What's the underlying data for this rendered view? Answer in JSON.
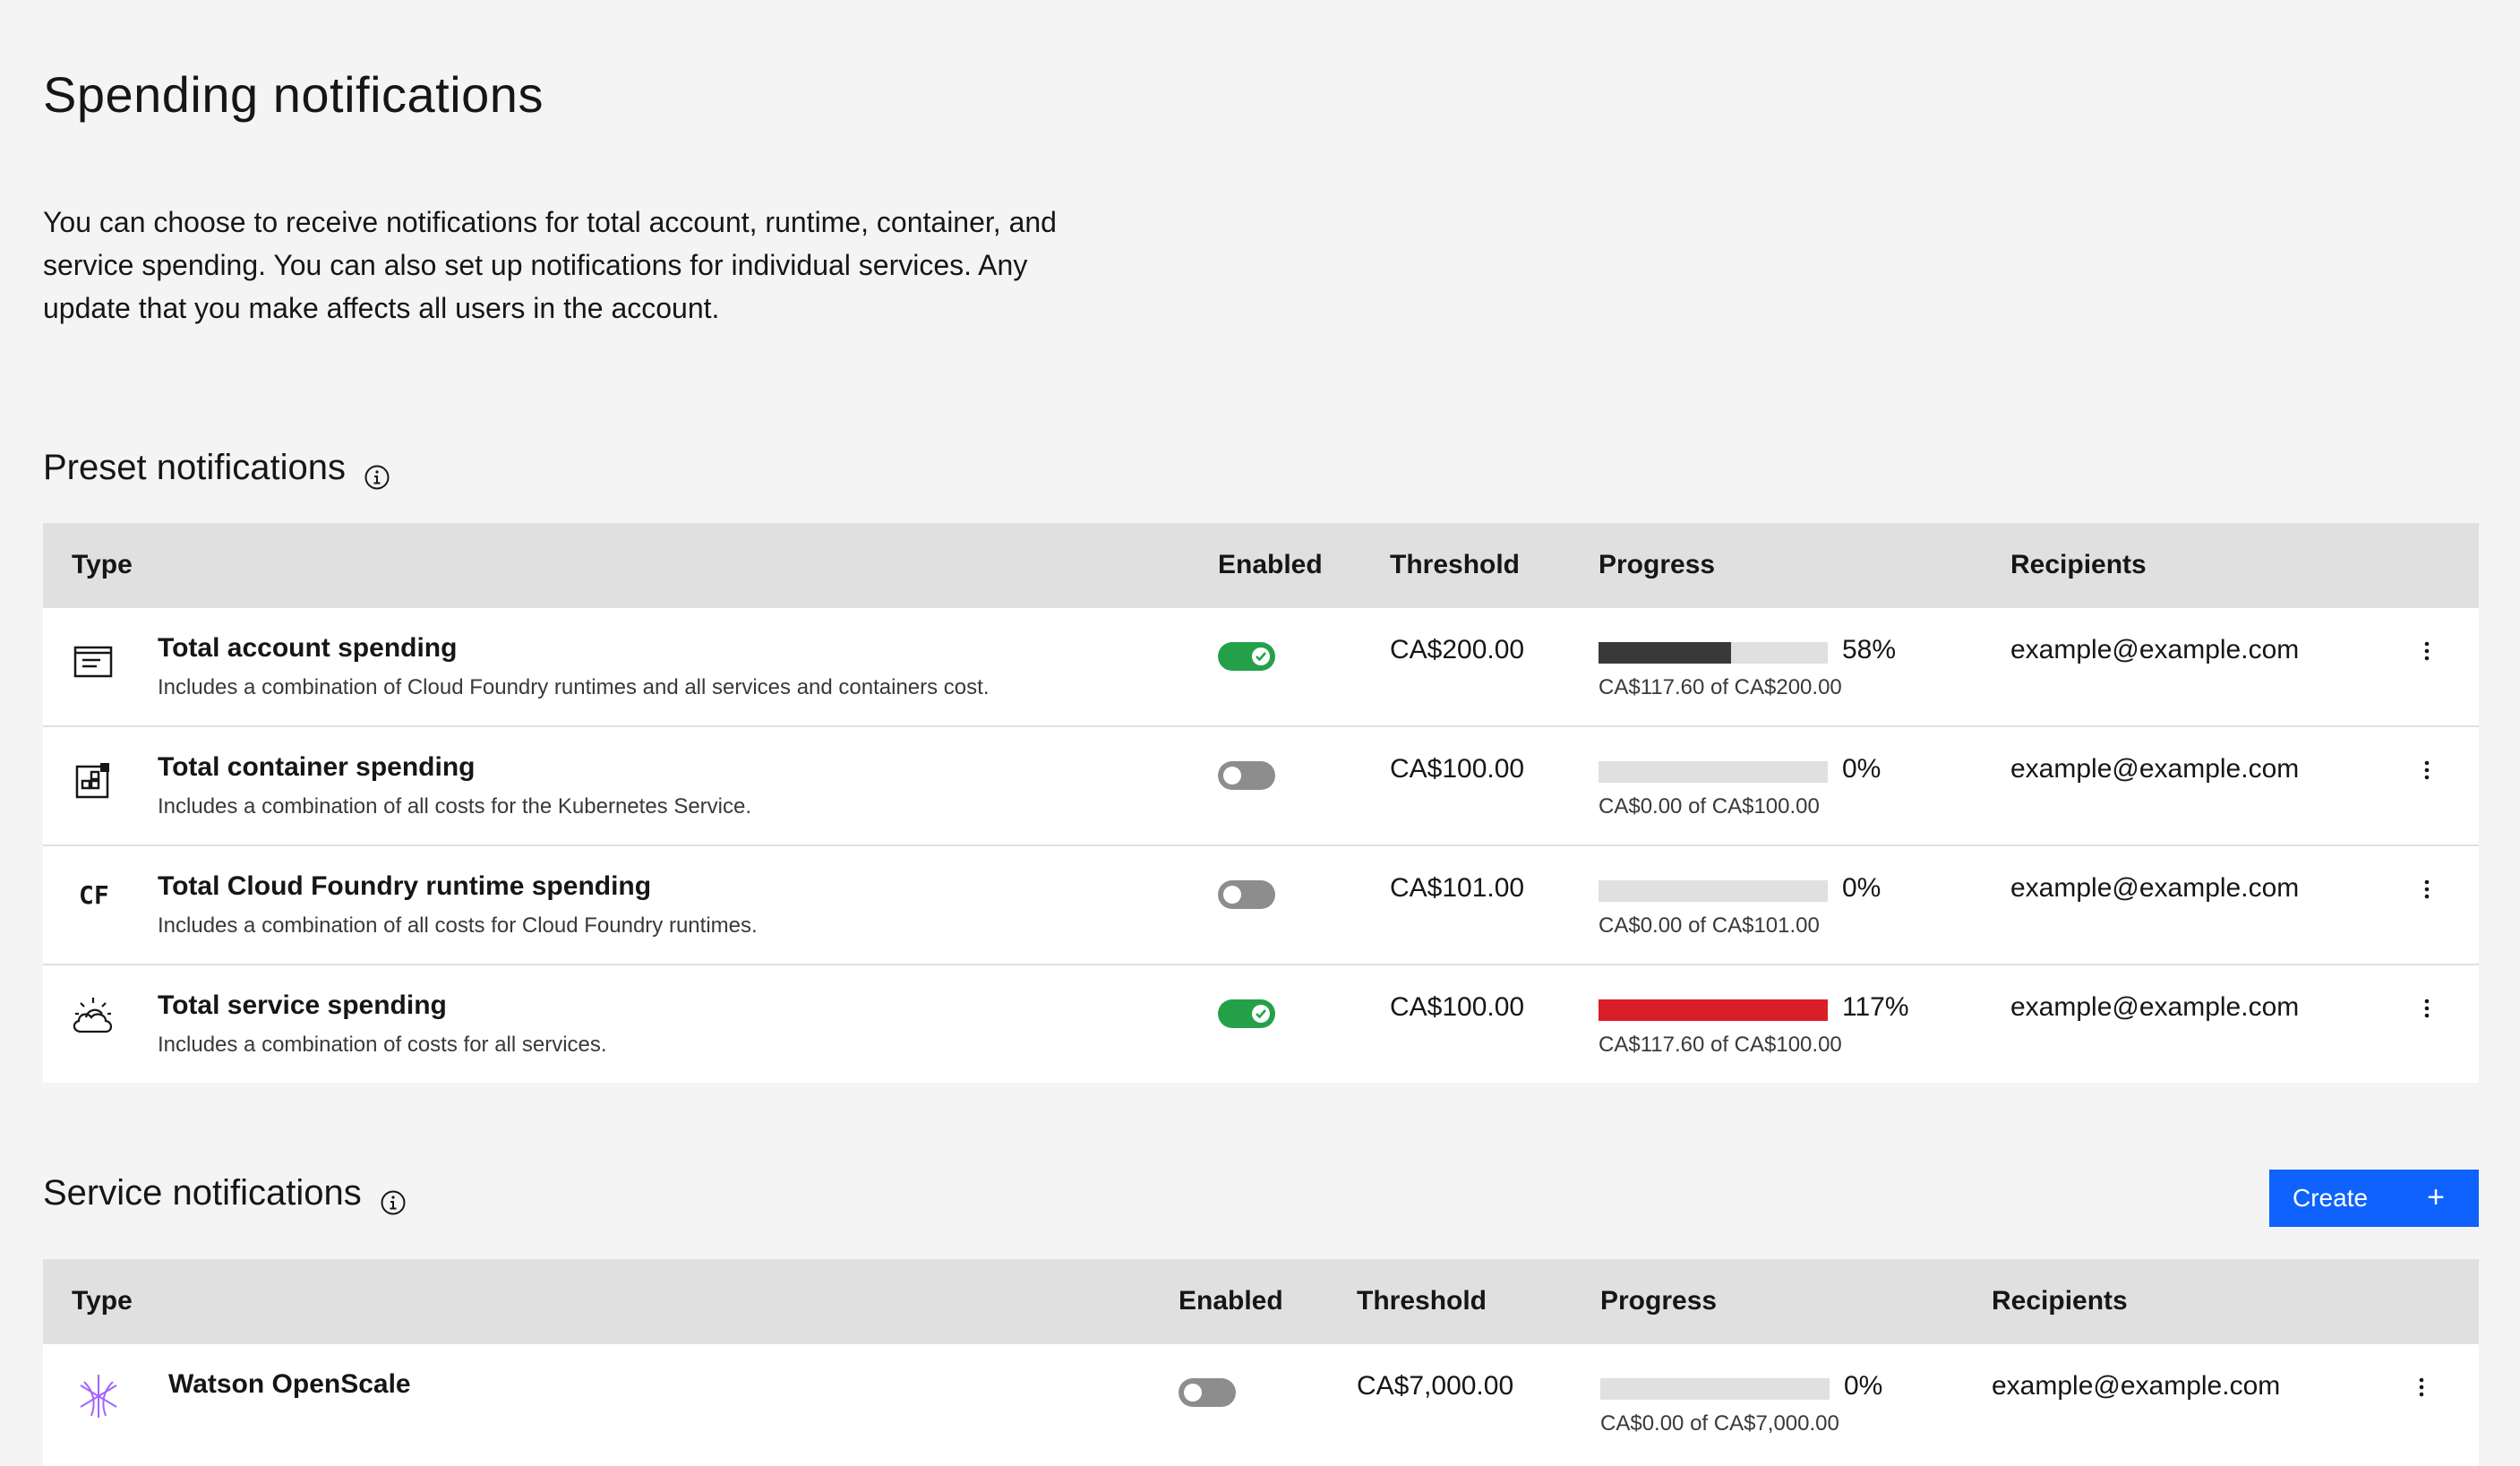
{
  "page": {
    "title": "Spending notifications",
    "description": "You can choose to receive notifications for total account, runtime, container, and service spending. You can also set up notifications for individual services. Any update that you make affects all users in the account."
  },
  "preset": {
    "title": "Preset notifications",
    "columns": {
      "type": "Type",
      "enabled": "Enabled",
      "threshold": "Threshold",
      "progress": "Progress",
      "recipients": "Recipients"
    },
    "rows": [
      {
        "icon": "account-spending-icon",
        "name": "Total account spending",
        "description": "Includes a combination of Cloud Foundry runtimes and all services and containers cost.",
        "enabled": true,
        "threshold": "CA$200.00",
        "progress_fraction": 0.58,
        "progress_percent": "58%",
        "progress_detail": "CA$117.60 of CA$200.00",
        "bar_color": "#393939",
        "recipient": "example@example.com"
      },
      {
        "icon": "container-spending-icon",
        "name": "Total container spending",
        "description": "Includes a combination of all costs for the Kubernetes Service.",
        "enabled": false,
        "threshold": "CA$100.00",
        "progress_fraction": 0,
        "progress_percent": "0%",
        "progress_detail": "CA$0.00 of CA$100.00",
        "bar_color": "#393939",
        "recipient": "example@example.com"
      },
      {
        "icon": "cloud-foundry-icon",
        "icon_text": "CF",
        "name": "Total Cloud Foundry runtime spending",
        "description": "Includes a combination of all costs for Cloud Foundry runtimes.",
        "enabled": false,
        "threshold": "CA$101.00",
        "progress_fraction": 0,
        "progress_percent": "0%",
        "progress_detail": "CA$0.00 of CA$101.00",
        "bar_color": "#393939",
        "recipient": "example@example.com"
      },
      {
        "icon": "service-spending-icon",
        "name": "Total service spending",
        "description": "Includes a combination of costs for all services.",
        "enabled": true,
        "threshold": "CA$100.00",
        "progress_fraction": 1.0,
        "progress_percent": "117%",
        "progress_detail": "CA$117.60 of CA$100.00",
        "bar_color": "#da1e28",
        "recipient": "example@example.com"
      }
    ]
  },
  "service": {
    "title": "Service notifications",
    "create_label": "Create",
    "create_icon": "+",
    "columns": {
      "type": "Type",
      "enabled": "Enabled",
      "threshold": "Threshold",
      "progress": "Progress",
      "recipients": "Recipients"
    },
    "rows": [
      {
        "icon": "watson-openscale-icon",
        "name": "Watson OpenScale",
        "enabled": false,
        "threshold": "CA$7,000.00",
        "progress_fraction": 0,
        "progress_percent": "0%",
        "progress_detail": "CA$0.00 of CA$7,000.00",
        "bar_color": "#393939",
        "recipient": "example@example.com"
      }
    ]
  },
  "colors": {
    "toggle_on": "#24a148",
    "toggle_off": "#8d8d8d",
    "primary_button": "#0f62fe",
    "over_budget": "#da1e28"
  }
}
